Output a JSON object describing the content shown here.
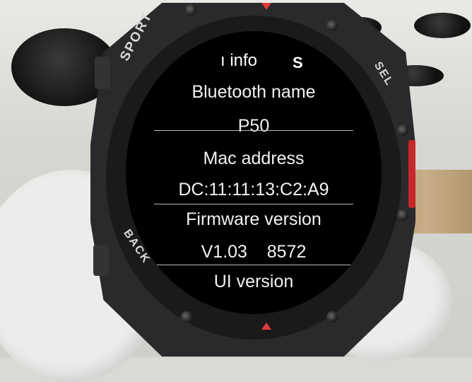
{
  "bezel_labels": {
    "sport": "SPORT",
    "sel": "SEL",
    "back": "BACK"
  },
  "screen": {
    "header_left": "ı info",
    "header_right": "S",
    "rows": [
      {
        "label": "Bluetooth name",
        "value": "P50"
      },
      {
        "label": "Mac address",
        "value": "DC:11:11:13:C2:A9"
      },
      {
        "label": "Firmware version",
        "value": "V1.03    8572"
      },
      {
        "label": "UI version",
        "value": ""
      }
    ]
  },
  "colors": {
    "screen_background": "#000000",
    "screen_text": "#f2f2f2",
    "accent_red": "#e23b3b"
  }
}
